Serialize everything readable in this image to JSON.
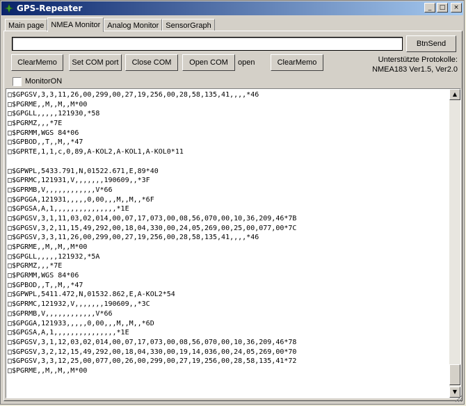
{
  "window": {
    "title": "GPS-Repeater",
    "buttons": {
      "minimize": "_",
      "maximize": "□",
      "close": "×"
    }
  },
  "tabs": [
    {
      "label": "Main page",
      "active": false
    },
    {
      "label": "NMEA Monitor",
      "active": true
    },
    {
      "label": "Analog Monitor",
      "active": false
    },
    {
      "label": "SensorGraph",
      "active": false
    }
  ],
  "send": {
    "input_value": "",
    "button_label": "BtnSend"
  },
  "toolbar": {
    "clear_memo_1": "ClearMemo",
    "set_com_port": "Set COM port",
    "close_com": "Close COM",
    "open_com": "Open COM",
    "status": "open",
    "clear_memo_2": "ClearMemo"
  },
  "protocols": {
    "line1": "Unterstützte Protokolle:",
    "line2": "NMEA183 Ver1.5,  Ver2.0"
  },
  "monitor": {
    "label": "MonitorON",
    "checked": false
  },
  "memo": {
    "lines": [
      "□$GPGSV,3,3,11,26,00,299,00,27,19,256,00,28,58,135,41,,,,*46",
      "□$PGRME,,M,,M,,M*00",
      "□$GPGLL,,,,,121930,*58",
      "□$PGRMZ,,,*7E",
      "□$PGRMM,WGS 84*06",
      "□$GPBOD,,T,,M,,*47",
      "□$GPRTE,1,1,c,0,89,A-KOL2,A-KOL1,A-KOL0*11",
      "",
      "□$GPWPL,5433.791,N,01522.671,E,89*40",
      "□$GPRMC,121931,V,,,,,,,190609,,*3F",
      "□$GPRMB,V,,,,,,,,,,,,V*66",
      "□$GPGGA,121931,,,,,0,00,,,M,,M,,*6F",
      "□$GPGSA,A,1,,,,,,,,,,,,,,,*1E",
      "□$GPGSV,3,1,11,03,02,014,00,07,17,073,00,08,56,070,00,10,36,209,46*7B",
      "□$GPGSV,3,2,11,15,49,292,00,18,04,330,00,24,05,269,00,25,00,077,00*7C",
      "□$GPGSV,3,3,11,26,00,299,00,27,19,256,00,28,58,135,41,,,,*46",
      "□$PGRME,,M,,M,,M*00",
      "□$GPGLL,,,,,121932,*5A",
      "□$PGRMZ,,,*7E",
      "□$PGRMM,WGS 84*06",
      "□$GPBOD,,T,,M,,*47",
      "□$GPWPL,5411.472,N,01532.862,E,A-KOL2*54",
      "□$GPRMC,121932,V,,,,,,,190609,,*3C",
      "□$GPRMB,V,,,,,,,,,,,,V*66",
      "□$GPGGA,121933,,,,,0,00,,,M,,M,,*6D",
      "□$GPGSA,A,1,,,,,,,,,,,,,,,*1E",
      "□$GPGSV,3,1,12,03,02,014,00,07,17,073,00,08,56,070,00,10,36,209,46*78",
      "□$GPGSV,3,2,12,15,49,292,00,18,04,330,00,19,14,036,00,24,05,269,00*70",
      "□$GPGSV,3,3,12,25,00,077,00,26,00,299,00,27,19,256,00,28,58,135,41*72",
      "□$PGRME,,M,,M,,M*00"
    ]
  }
}
